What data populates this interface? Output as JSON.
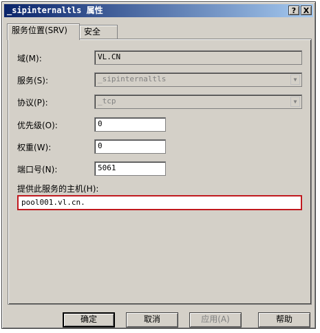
{
  "window": {
    "title": "_sipinternaltls 属性",
    "help_glyph": "?",
    "close_glyph": "X"
  },
  "tabs": [
    {
      "label": "服务位置(SRV)",
      "active": true
    },
    {
      "label": "安全",
      "active": false
    }
  ],
  "form": {
    "domain": {
      "label": "域(M):",
      "value": "VL.CN"
    },
    "service": {
      "label": "服务(S):",
      "value": "_sipinternaltls"
    },
    "protocol": {
      "label": "协议(P):",
      "value": "_tcp"
    },
    "priority": {
      "label": "优先级(O):",
      "value": "0"
    },
    "weight": {
      "label": "权重(W):",
      "value": "0"
    },
    "port": {
      "label": "端口号(N):",
      "value": "5061"
    },
    "host": {
      "label": "提供此服务的主机(H):",
      "value": "pool001.vl.cn."
    }
  },
  "buttons": {
    "ok": "确定",
    "cancel": "取消",
    "apply": "应用(A)",
    "help": "帮助"
  },
  "colors": {
    "titlebar_start": "#0a246a",
    "titlebar_end": "#a6caf0",
    "highlight_border": "#c0171d",
    "dialog_bg": "#d4d0c8"
  }
}
